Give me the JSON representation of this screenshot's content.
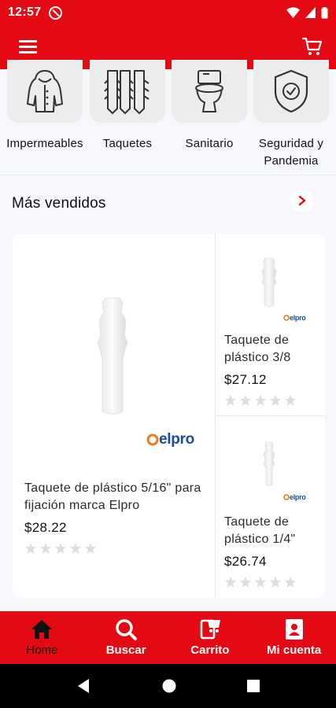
{
  "status_bar": {
    "time": "12:57"
  },
  "categories": [
    {
      "label": "Impermeables",
      "icon": "raincoat-icon"
    },
    {
      "label": "Taquetes",
      "icon": "wall-plugs-icon"
    },
    {
      "label": "Sanitario",
      "icon": "toilet-icon"
    },
    {
      "label": "Seguridad y Pandemia",
      "icon": "shield-check-icon"
    }
  ],
  "section": {
    "title": "Más vendidos"
  },
  "products": [
    {
      "name": "Taquete de plástico 5/16\" para fijación marca Elpro",
      "price": "$28.22",
      "brand": "elpro",
      "rating": 0
    },
    {
      "name": "Taquete de plástico 3/8",
      "price": "$27.12",
      "brand": "elpro",
      "rating": 0
    },
    {
      "name": "Taquete de plástico 1/4\"",
      "price": "$26.74",
      "brand": "elpro",
      "rating": 0
    }
  ],
  "bottom_nav": [
    {
      "label": "Home",
      "icon": "home-icon",
      "active": true
    },
    {
      "label": "Buscar",
      "icon": "search-icon",
      "active": false
    },
    {
      "label": "Carrito",
      "icon": "cart-icon",
      "active": false
    },
    {
      "label": "Mi cuenta",
      "icon": "account-icon",
      "active": false
    }
  ],
  "colors": {
    "brand": "#e50914",
    "active_nav": "#111111",
    "logo_blue": "#1b4aa0",
    "logo_orange": "#f07a1a",
    "star": "#dddddd"
  }
}
